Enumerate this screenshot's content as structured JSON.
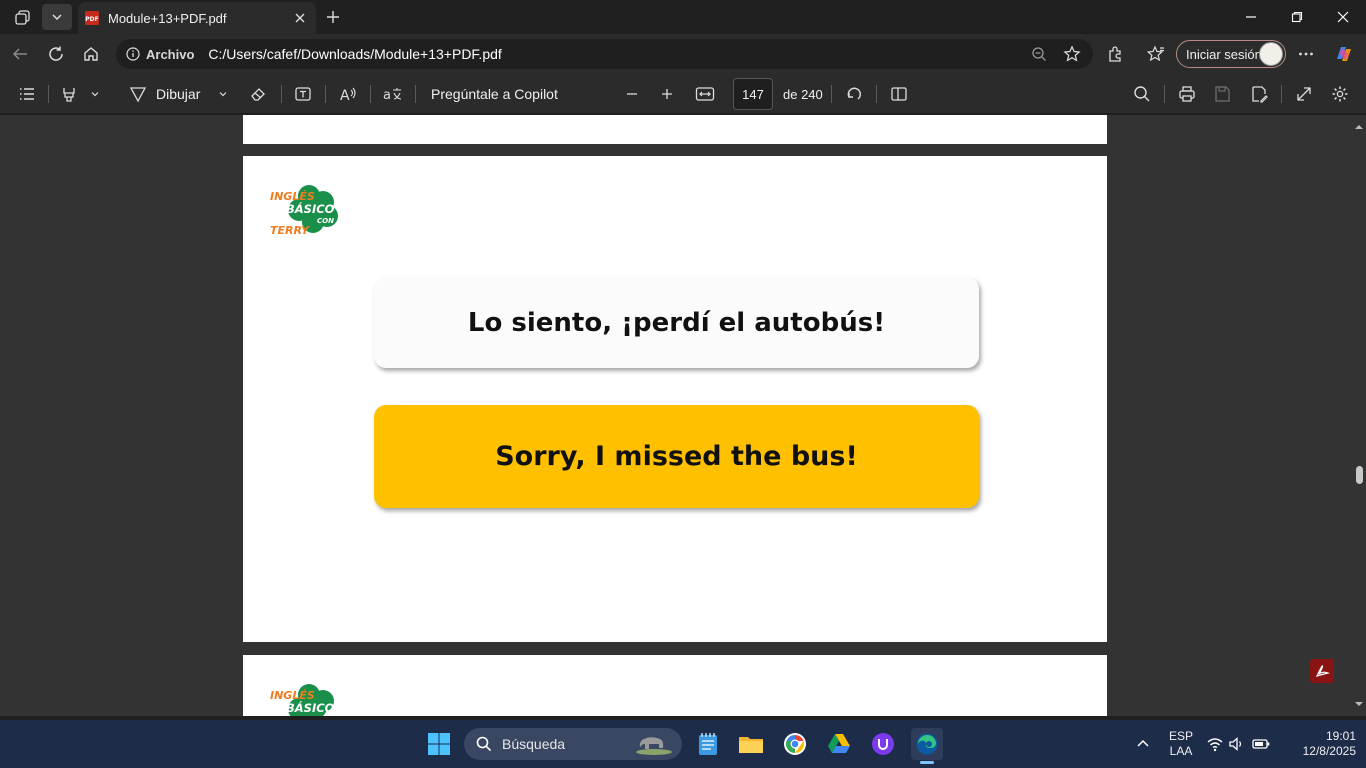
{
  "browser": {
    "tab_title": "Module+13+PDF.pdf",
    "address_label": "Archivo",
    "url": "C:/Users/cafef/Downloads/Module+13+PDF.pdf",
    "signin_label": "Iniciar sesión"
  },
  "pdf_toolbar": {
    "draw_label": "Dibujar",
    "copilot_label": "Pregúntale a Copilot",
    "page_number": "147",
    "page_total": "de 240"
  },
  "document": {
    "logo": {
      "line1": "INGLÉS",
      "line2": "BÁSICO",
      "line3": "CON",
      "line4": "TERRY"
    },
    "spanish_phrase": "Lo siento, ¡perdí el autobús!",
    "english_phrase": "Sorry, I missed the bus!",
    "scroll_position": 0.61
  },
  "taskbar": {
    "search_label": "Búsqueda",
    "language_line1": "ESP",
    "language_line2": "LAA",
    "time": "19:01",
    "date": "12/8/2025"
  },
  "colors": {
    "accent_yellow": "#ffc000",
    "logo_green": "#1a8f4a",
    "logo_orange": "#f07c1e",
    "taskbar": "#1d2c49"
  }
}
